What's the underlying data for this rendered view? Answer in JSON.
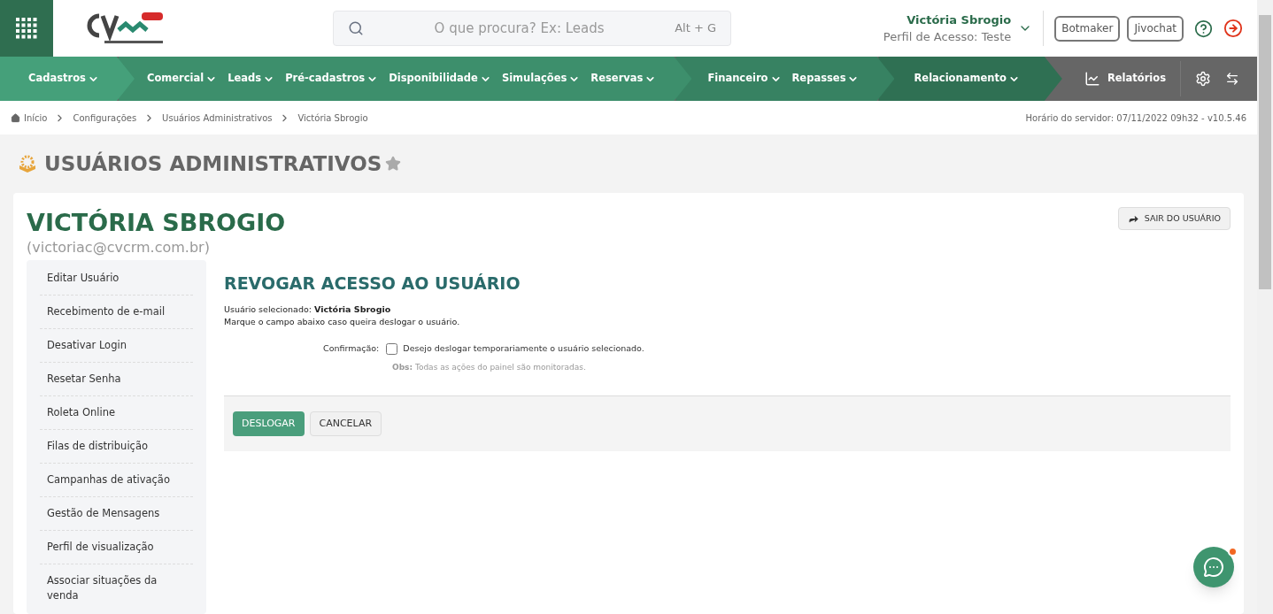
{
  "search": {
    "placeholder": "O que procura? Ex: Leads",
    "shortcut": "Alt + G"
  },
  "user": {
    "name": "Victória Sbrogio",
    "profile": "Perfil de Acesso: Teste"
  },
  "header_buttons": [
    "Botmaker",
    "Jivochat"
  ],
  "nav": {
    "groups": [
      {
        "items": [
          "Cadastros"
        ]
      },
      {
        "items": [
          "Comercial",
          "Leads",
          "Pré-cadastros",
          "Disponibilidade",
          "Simulações",
          "Reservas"
        ]
      },
      {
        "items": [
          "Financeiro",
          "Repasses"
        ]
      },
      {
        "items": [
          "Relacionamento"
        ]
      }
    ],
    "reports": "Relatórios"
  },
  "breadcrumb": [
    "Início",
    "Configurações",
    "Usuários Administrativos",
    "Victória Sbrogio"
  ],
  "server_time": "Horário do servidor: 07/11/2022 09h32 - v10.5.46",
  "page_title": "USUÁRIOS ADMINISTRATIVOS",
  "profile": {
    "name": "VICTÓRIA SBROGIO",
    "email": "(victoriac@cvcrm.com.br)",
    "exit_button": "SAIR DO USUÁRIO"
  },
  "sidebar": {
    "items": [
      "Editar Usuário",
      "Recebimento de e-mail",
      "Desativar Login",
      "Resetar Senha",
      "Roleta Online",
      "Filas de distribuição",
      "Campanhas de ativação",
      "Gestão de Mensagens",
      "Perfil de visualização",
      "Associar situações da venda"
    ]
  },
  "form": {
    "title": "REVOGAR ACESSO AO USUÁRIO",
    "selected_user": "Usuário selecionado: **Victória Sbrogio**",
    "instruction": "Marque o campo abaixo caso queira deslogar o usuário.",
    "confirm_label": "Confirmação:",
    "checkbox": {
      "label": "Desejo deslogar temporariamente o usuário selecionado.",
      "checked": false
    },
    "note": "**Obs:** Todas as ações do painel são monitoradas.",
    "buttons": [
      {
        "label": "DESLOGAR",
        "kind": "primary"
      },
      {
        "label": "CANCELAR",
        "kind": "secondary"
      }
    ]
  },
  "chat": {
    "unread": true
  }
}
